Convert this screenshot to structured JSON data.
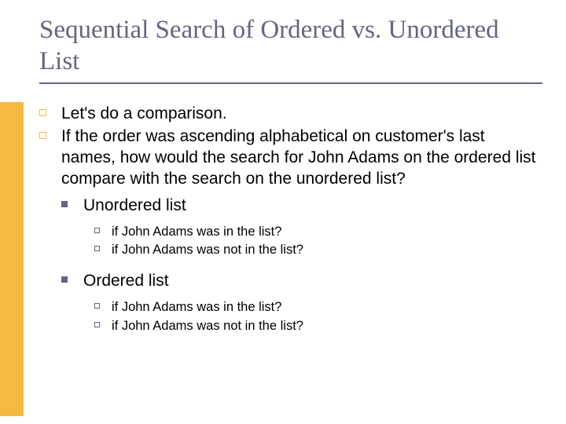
{
  "title": "Sequential Search of Ordered vs. Unordered List",
  "bullets": {
    "b1": "Let's do a comparison.",
    "b2": "If the order was ascending alphabetical on customer's last names, how would the search for John Adams on the ordered list compare with the search on the unordered list?",
    "b2_1": "Unordered list",
    "b2_1_a": "if John Adams was in the list?",
    "b2_1_b": "if John Adams was not in the list?",
    "b2_2": "Ordered list",
    "b2_2_a": "if John Adams was in the list?",
    "b2_2_b": "if John Adams was not in the list?"
  }
}
